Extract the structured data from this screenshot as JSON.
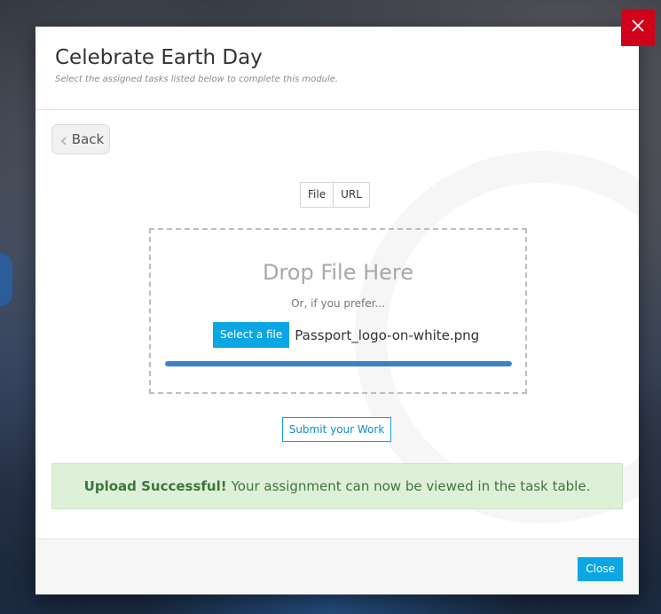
{
  "modal": {
    "title": "Celebrate Earth Day",
    "subtitle": "Select the assigned tasks listed below to complete this module."
  },
  "back_button": {
    "label": "Back",
    "icon": "chevron-left-icon"
  },
  "upload_tabs": [
    {
      "label": "File"
    },
    {
      "label": "URL"
    }
  ],
  "dropzone": {
    "title": "Drop File Here",
    "subtitle": "Or, if you prefer...",
    "select_label": "Select a file",
    "file_name": "Passport_logo-on-white.png",
    "progress_fraction": 1.0
  },
  "submit_button": {
    "label": "Submit your Work"
  },
  "alert": {
    "strong": "Upload Successful!",
    "message": "Your assignment can now be viewed in the task table."
  },
  "footer": {
    "close_label": "Close"
  },
  "close_x": {
    "icon": "close-icon"
  },
  "colors": {
    "accent": "#0aa7e4",
    "progress": "#3b82c4",
    "success_bg": "#dff0d8",
    "success_text": "#3c763d",
    "close_x_bg": "#d0021b"
  }
}
